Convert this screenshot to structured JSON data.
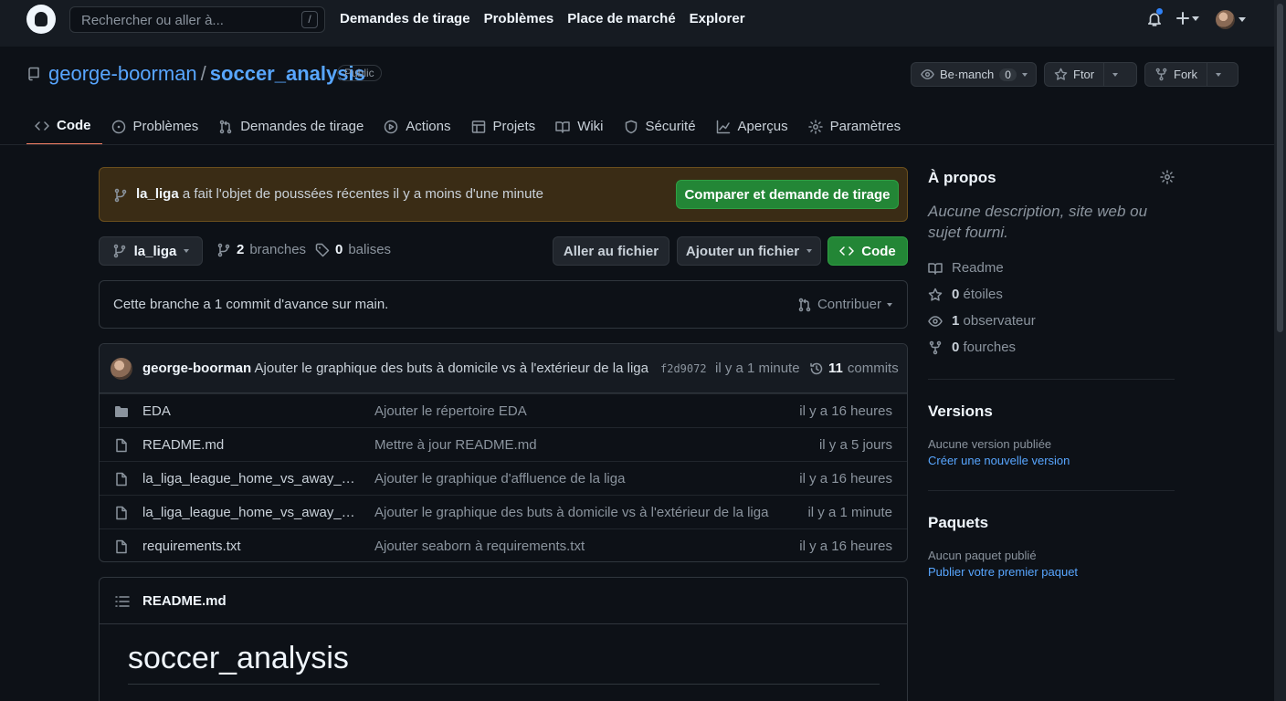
{
  "header": {
    "search_placeholder": "Rechercher ou aller à...",
    "search_shortcut": "/",
    "nav": [
      "Demandes de tirage",
      "Problèmes",
      "Place de marché",
      "Explorer"
    ]
  },
  "repo": {
    "owner": "george-boorman",
    "separator": "/",
    "name": "soccer_analysis",
    "visibility": "Public",
    "watch": {
      "label": "Be·manch",
      "count": "0"
    },
    "star": {
      "label": "Ftor"
    },
    "fork": {
      "label": "Fork"
    }
  },
  "tabs": [
    "Code",
    "Problèmes",
    "Demandes de tirage",
    "Actions",
    "Projets",
    "Wiki",
    "Sécurité",
    "Aperçus",
    "Paramètres"
  ],
  "flash": {
    "branch": "la_liga",
    "message": " a fait l'objet de poussées récentes il y a moins d'une minute",
    "button": "Comparer et demande de tirage"
  },
  "branch_bar": {
    "current_branch": "la_liga",
    "branches_count": "2",
    "branches_label": "branches",
    "tags_count": "0",
    "tags_label": "balises",
    "goto_file": "Aller au fichier",
    "add_file": "Ajouter un fichier",
    "code": "Code"
  },
  "ahead": {
    "text": "Cette branche a 1 commit d'avance sur main.",
    "contribute": "Contribuer"
  },
  "latest_commit": {
    "author": "george-boorman",
    "message": " Ajouter le graphique des buts à domicile vs à l'extérieur de la liga",
    "sha": "f2d9072",
    "time": "il y a 1 minute",
    "commits_count": "11",
    "commits_label": "commits"
  },
  "files": [
    {
      "type": "folder",
      "name": "EDA",
      "message": "Ajouter le répertoire EDA",
      "age": "il y a 16 heures"
    },
    {
      "type": "file",
      "name": "README.md",
      "message": "Mettre à jour README.md",
      "age": "il y a 5 jours"
    },
    {
      "type": "file",
      "name": "la_liga_league_home_vs_away_att...",
      "message": "Ajouter le graphique d'affluence de la liga",
      "age": "il y a 16 heures"
    },
    {
      "type": "file",
      "name": "la_liga_league_home_vs_away_goa...",
      "message": "Ajouter le graphique des buts à domicile vs à l'extérieur de la liga",
      "age": "il y a 1 minute"
    },
    {
      "type": "file",
      "name": "requirements.txt",
      "message": "Ajouter seaborn à requirements.txt",
      "age": "il y a 16 heures"
    }
  ],
  "readme": {
    "filename": "README.md",
    "heading": "soccer_analysis"
  },
  "sidebar": {
    "about_title": "À propos",
    "description": "Aucune description, site web ou sujet fourni.",
    "readme": "Readme",
    "stars_count": "0",
    "stars_label": "étoiles",
    "watchers_count": "1",
    "watchers_label": "observateur",
    "forks_count": "0",
    "forks_label": "fourches",
    "releases_title": "Versions",
    "releases_none": "Aucune version publiée",
    "releases_link": "Créer une nouvelle version",
    "packages_title": "Paquets",
    "packages_none": "Aucun paquet publié",
    "packages_link": "Publier votre premier paquet"
  }
}
